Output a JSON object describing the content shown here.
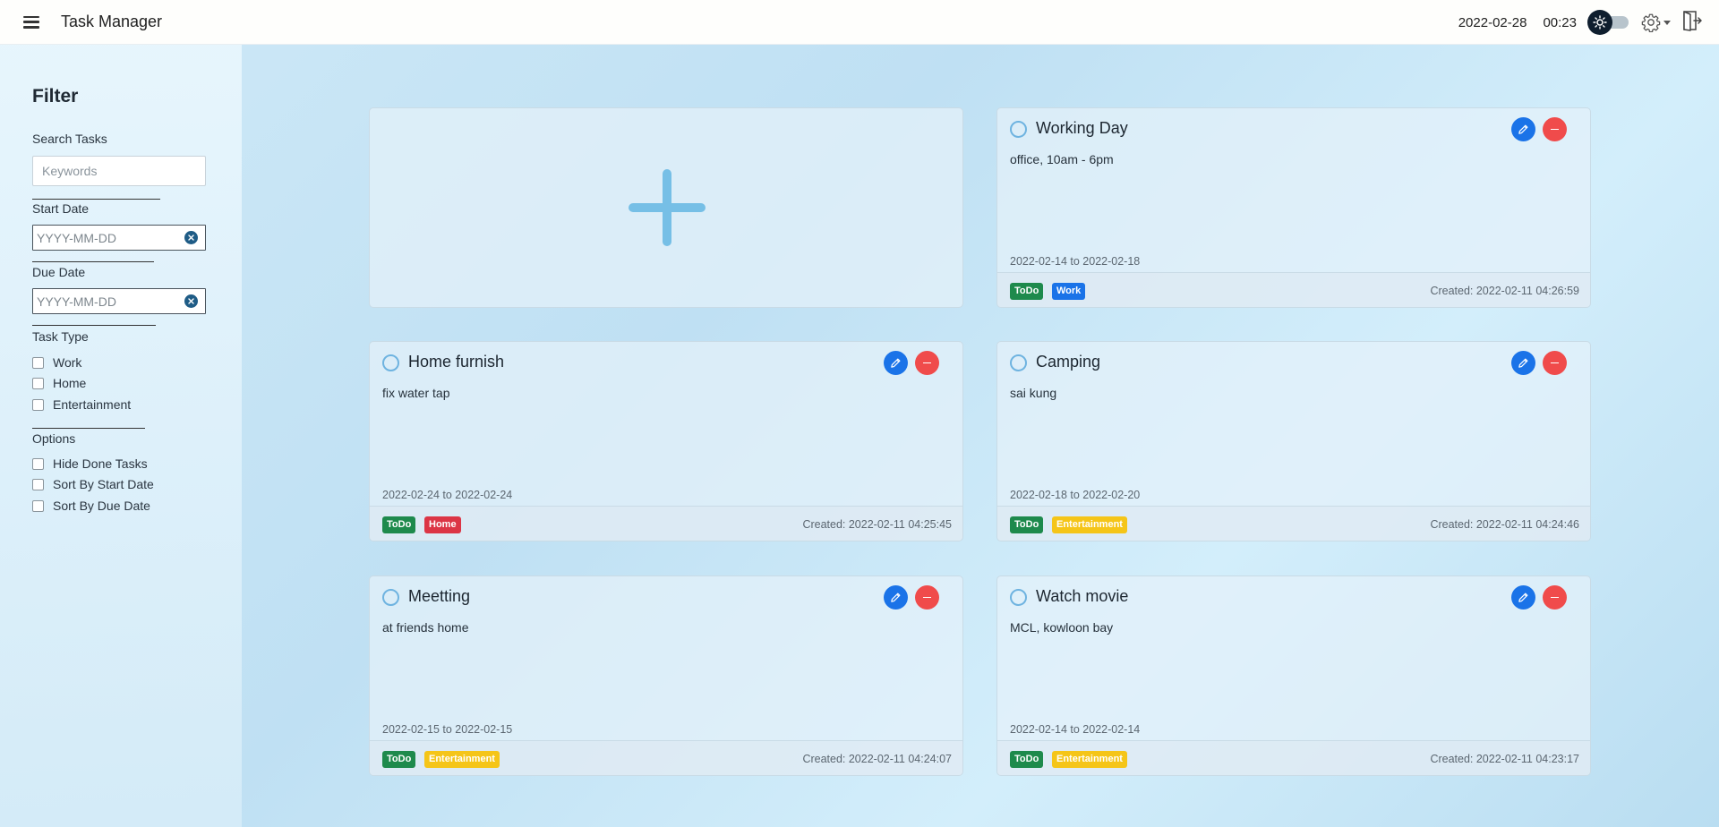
{
  "app": {
    "title": "Task Manager"
  },
  "header": {
    "date": "2022-02-28",
    "time": "00:23"
  },
  "icons": {
    "menu": "hamburger-icon",
    "theme": "sun-icon",
    "settings": "gear-icon",
    "exit": "exit-door-icon",
    "clear": "clear-x-icon",
    "edit": "pencil-icon",
    "delete": "minus-icon",
    "add": "plus-icon"
  },
  "colors": {
    "edit": "#1a73e8",
    "delete": "#f04b4b",
    "todo": "#1e8a4c",
    "work": "#1a73e8",
    "home": "#dc3545",
    "entertainment": "#f5c518"
  },
  "sidebar": {
    "title": "Filter",
    "search_label": "Search Tasks",
    "search_placeholder": "Keywords",
    "start_label": "Start Date",
    "start_placeholder": "YYYY-MM-DD",
    "due_label": "Due Date",
    "due_placeholder": "YYYY-MM-DD",
    "type_label": "Task Type",
    "types": [
      "Work",
      "Home",
      "Entertainment"
    ],
    "options_label": "Options",
    "options": [
      "Hide Done Tasks",
      "Sort By Start Date",
      "Sort By Due Date"
    ]
  },
  "tasks": [
    {
      "title": "Working Day",
      "desc": "office, 10am - 6pm",
      "range": "2022-02-14 to 2022-02-18",
      "status": "ToDo",
      "type": "Work",
      "created": "Created: 2022-02-11  04:26:59"
    },
    {
      "title": "Home furnish",
      "desc": "fix water tap",
      "range": "2022-02-24 to 2022-02-24",
      "status": "ToDo",
      "type": "Home",
      "created": "Created: 2022-02-11  04:25:45"
    },
    {
      "title": "Camping",
      "desc": "sai kung",
      "range": "2022-02-18 to 2022-02-20",
      "status": "ToDo",
      "type": "Entertainment",
      "created": "Created: 2022-02-11  04:24:46"
    },
    {
      "title": "Meetting",
      "desc": "at friends home",
      "range": "2022-02-15 to 2022-02-15",
      "status": "ToDo",
      "type": "Entertainment",
      "created": "Created: 2022-02-11  04:24:07"
    },
    {
      "title": "Watch movie",
      "desc": "MCL, kowloon bay",
      "range": "2022-02-14 to 2022-02-14",
      "status": "ToDo",
      "type": "Entertainment",
      "created": "Created: 2022-02-11  04:23:17"
    }
  ]
}
